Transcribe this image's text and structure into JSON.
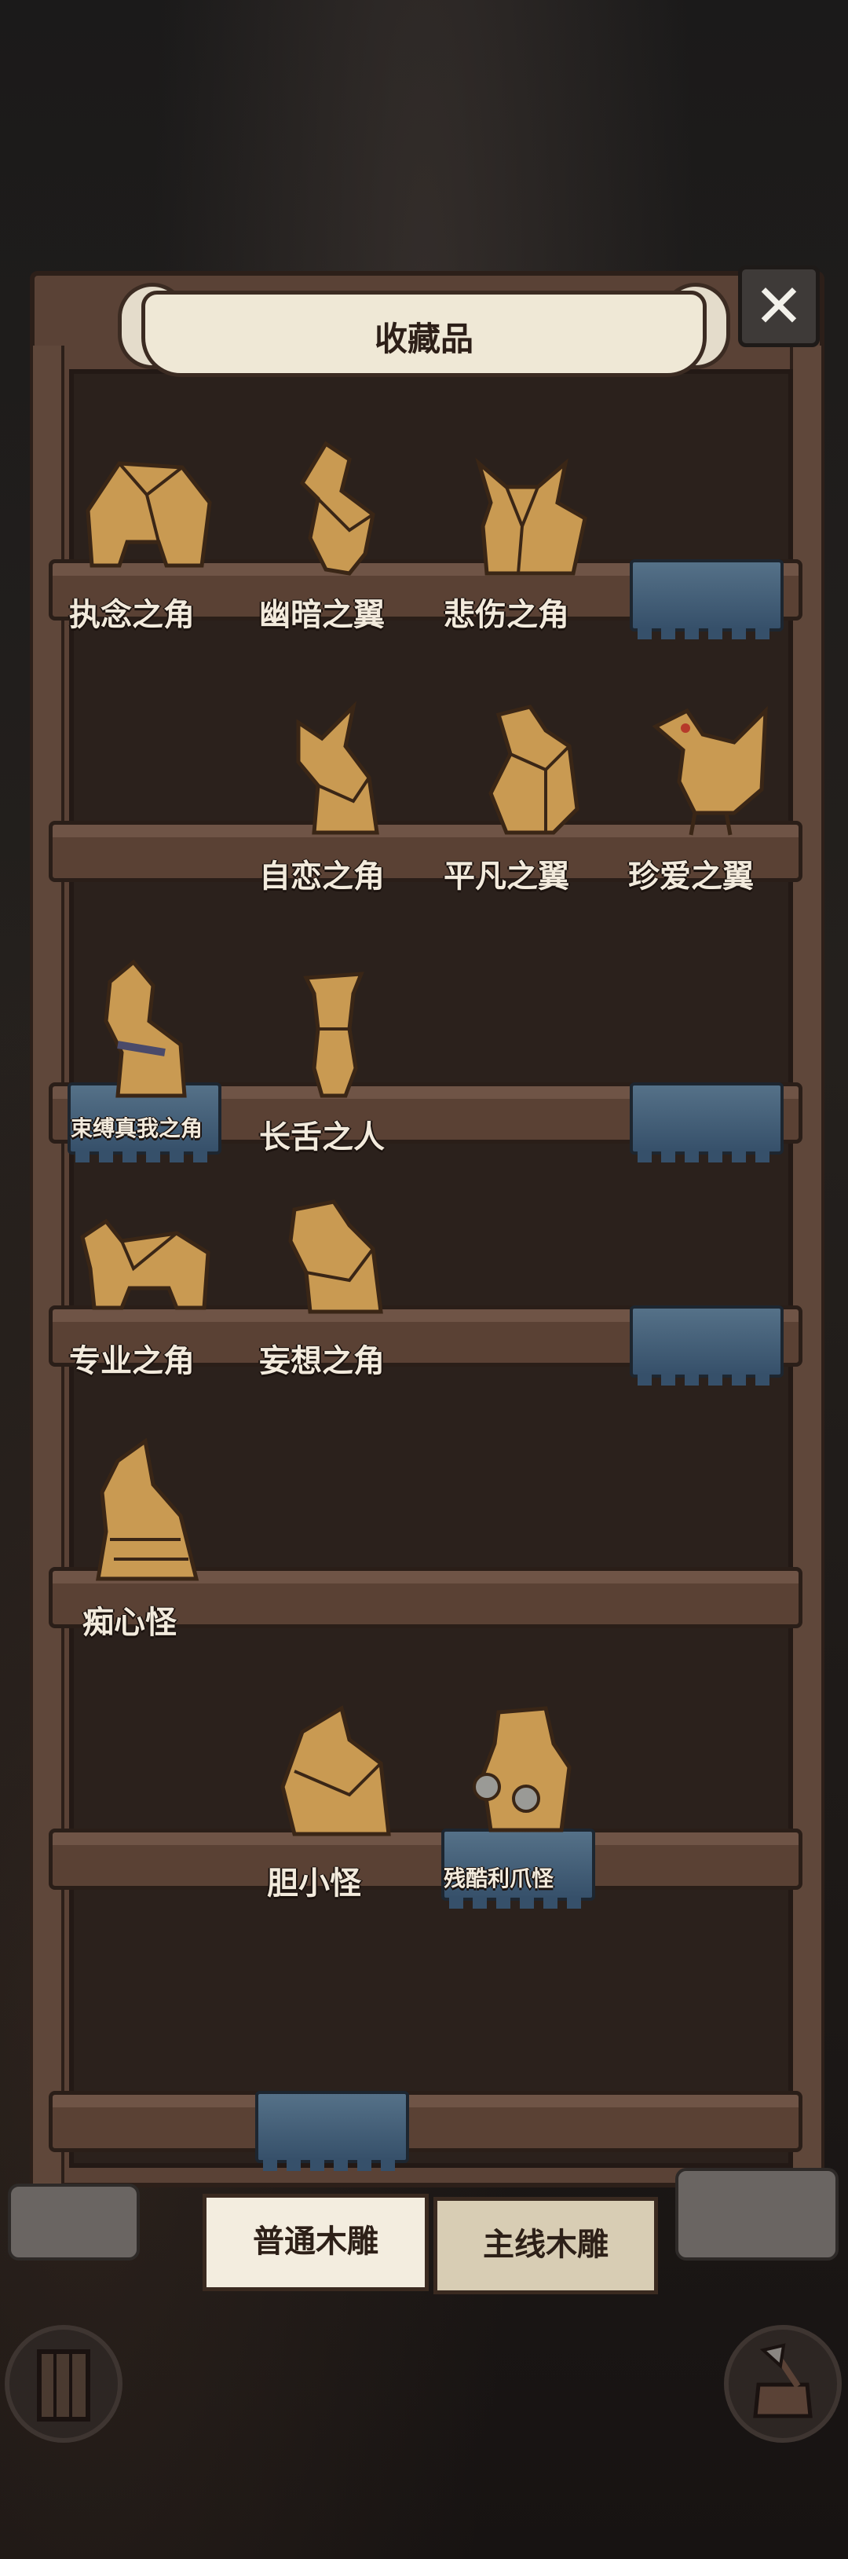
{
  "title": "收藏品",
  "close_icon": "close-x-icon",
  "shelves": [
    {
      "labels": [
        "执念之角",
        "幽暗之翼",
        "悲伤之角"
      ]
    },
    {
      "labels": [
        "自恋之角",
        "平凡之翼",
        "珍爱之翼"
      ]
    },
    {
      "labels": [
        "束缚真我之角",
        "长舌之人"
      ]
    },
    {
      "labels": [
        "专业之角",
        "妄想之角"
      ]
    },
    {
      "labels": [
        "痴心怪"
      ]
    },
    {
      "labels": [
        "胆小怪",
        "残酷利爪怪"
      ]
    },
    {
      "labels": []
    }
  ],
  "tabs": {
    "normal": "普通木雕",
    "main": "主线木雕"
  },
  "bottom_left_icon": "door-icon",
  "bottom_right_icon": "axe-stump-icon",
  "colors": {
    "wood": "#5a4236",
    "cloth": "#557188",
    "carving": "#c99a52",
    "banner": "#efe8d6"
  }
}
